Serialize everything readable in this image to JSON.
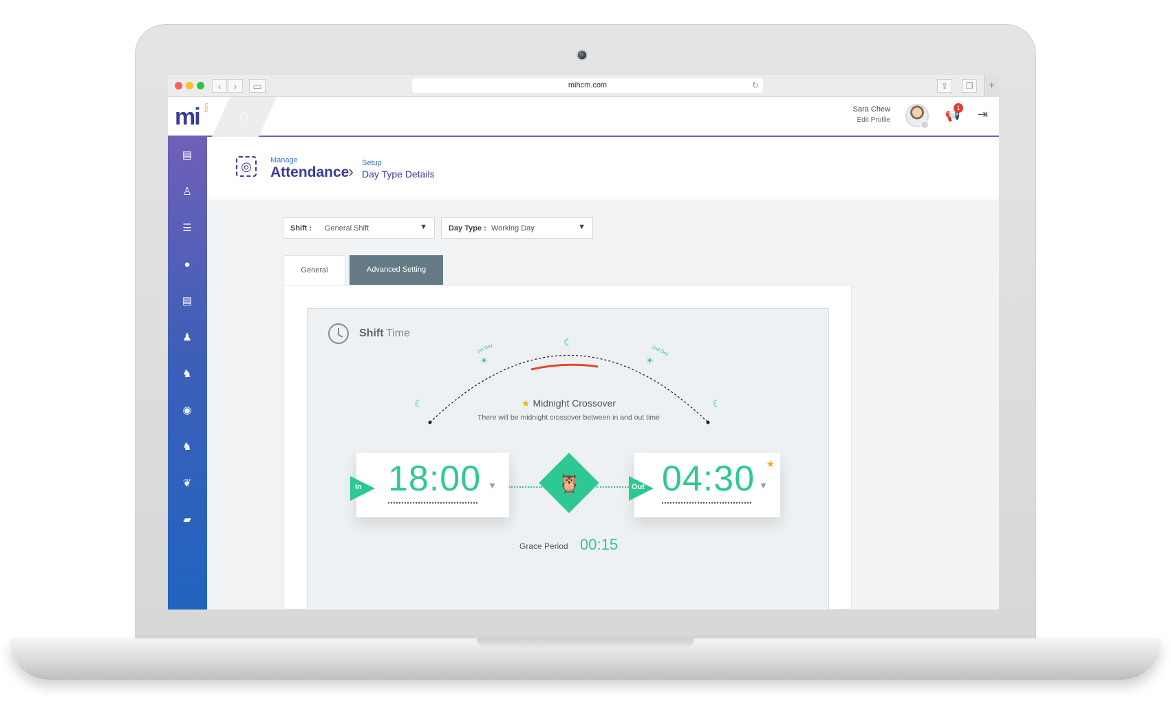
{
  "browser": {
    "url": "mihcm.com"
  },
  "header": {
    "logo_text": "mi",
    "logo_sub": "hcm",
    "user_name": "Sara Chew",
    "edit_profile": "Edit Profile",
    "notification_count": "1"
  },
  "breadcrumb": {
    "module_prefix": "Manage",
    "module": "Attendance",
    "section_prefix": "Setup",
    "page": "Day Type Details"
  },
  "filters": {
    "shift_label": "Shift :",
    "shift_value": "General Shift",
    "day_type_label": "Day Type :",
    "day_type_value": "Working Day"
  },
  "tabs": [
    {
      "label": "General",
      "active": true
    },
    {
      "label": "Advanced Setting",
      "active": false
    }
  ],
  "shift_time": {
    "title_bold": "Shift",
    "title_light": "Time",
    "first_day_label": "1st Day",
    "second_day_label": "2nd Day",
    "crossover_title": "Midnight Crossover",
    "crossover_desc": "There will be midnight crossover between in and out time",
    "in_label": "In",
    "in_time": "18:00",
    "out_label": "Out",
    "out_time": "04:30",
    "grace_label": "Grace Period",
    "grace_value": "00:15"
  },
  "colors": {
    "accent_green": "#2ec992",
    "brand_purple": "#3b3a99",
    "crossover_red": "#e6472b",
    "tab_active_dark": "#647b86"
  },
  "icons": {
    "sidebar": [
      "report-icon",
      "employee-icon",
      "list-icon",
      "profile-icon",
      "document-icon",
      "user-settings-icon",
      "assign-icon",
      "fingerprint-icon",
      "assign-icon",
      "handshake-icon",
      "card-icon"
    ]
  }
}
